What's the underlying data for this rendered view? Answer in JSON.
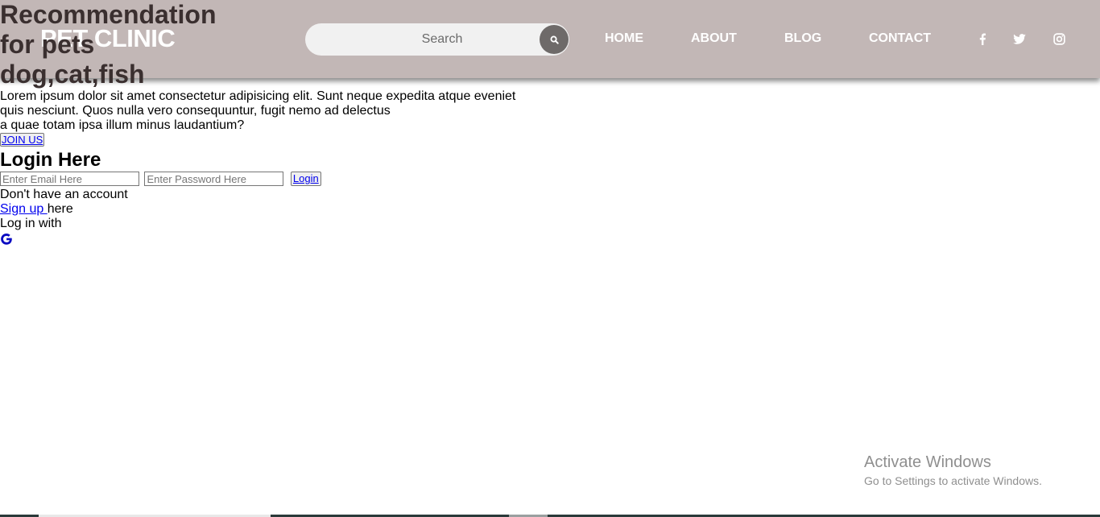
{
  "navbar": {
    "brand": "PET CLINIC",
    "search": {
      "placeholder": "Search",
      "icon": "search-icon"
    },
    "links": [
      "HOME",
      "ABOUT",
      "BLOG",
      "CONTACT"
    ],
    "social_icons": [
      "facebook-icon",
      "twitter-icon",
      "instagram-icon"
    ],
    "background_color": "#c2b7b6"
  },
  "hero": {
    "title": "Recommendation for pets dog,cat,fish",
    "text": "Lorem ipsum dolor sit amet consectetur adipisicing elit. Sunt neque expedita atque eveniet quis nesciunt. Quos nulla vero consequuntur, fugit nemo ad delectus",
    "text_line3": "a quae totam ipsa illum minus laudantium?",
    "join_label": "JOIN US"
  },
  "login": {
    "title": "Login Here",
    "email_placeholder": "Enter Email Here",
    "password_placeholder": "Enter Password Here",
    "login_label": "Login",
    "no_account": "Don't have an account",
    "signup_link": "Sign up ",
    "signup_suffix": "here",
    "login_with": "Log in with",
    "google_icon": "google-icon"
  },
  "watermark": {
    "title": "Activate Windows",
    "subtitle": "Go to Settings to activate Windows."
  }
}
